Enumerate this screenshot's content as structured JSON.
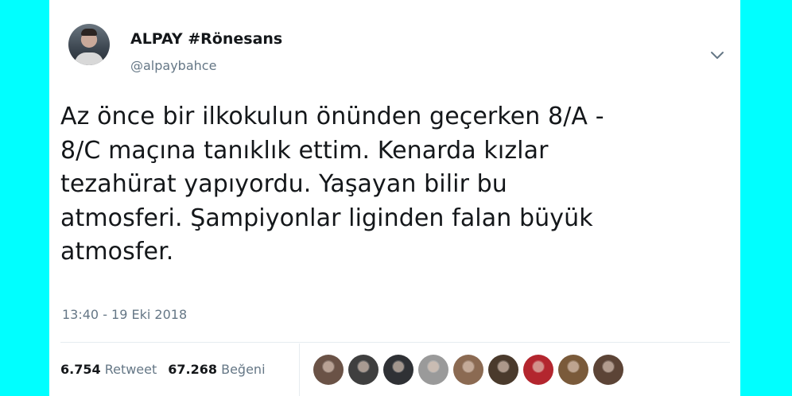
{
  "tweet": {
    "display_name": "ALPAY #Rönesans",
    "handle": "@alpaybahce",
    "text": "Az önce bir ilkokulun önünden geçerken 8/A -\n8/C maçına tanıklık ettim. Kenarda kızlar\ntezahürat yapıyordu. Yaşayan bilir bu\natmosferi. Şampiyonlar liginden falan büyük\natmosfer.",
    "timestamp": "13:40 - 19 Eki 2018"
  },
  "stats": {
    "retweet_count": "6.754",
    "retweet_label": "Retweet",
    "like_count": "67.268",
    "like_label": "Beğeni"
  },
  "likers": [
    {
      "icon": "liker-avatar-icon",
      "color": "#6a5246"
    },
    {
      "icon": "liker-avatar-icon",
      "color": "#3f3f3f"
    },
    {
      "icon": "liker-avatar-icon",
      "color": "#2f3135"
    },
    {
      "icon": "liker-avatar-icon",
      "color": "#9a9a9a"
    },
    {
      "icon": "liker-avatar-icon",
      "color": "#8b6a52"
    },
    {
      "icon": "liker-avatar-icon",
      "color": "#4a3a2c"
    },
    {
      "icon": "liker-avatar-icon",
      "color": "#b3262e"
    },
    {
      "icon": "liker-avatar-icon",
      "color": "#7a5a3a"
    },
    {
      "icon": "liker-avatar-icon",
      "color": "#5c4436"
    }
  ],
  "colors": {
    "background": "#00ffff",
    "card": "#ffffff",
    "text_primary": "#14171a",
    "text_secondary": "#657786",
    "divider": "#e6ecf0"
  },
  "icons": {
    "profile_avatar": "profile-avatar-icon",
    "caret": "chevron-down-icon"
  }
}
